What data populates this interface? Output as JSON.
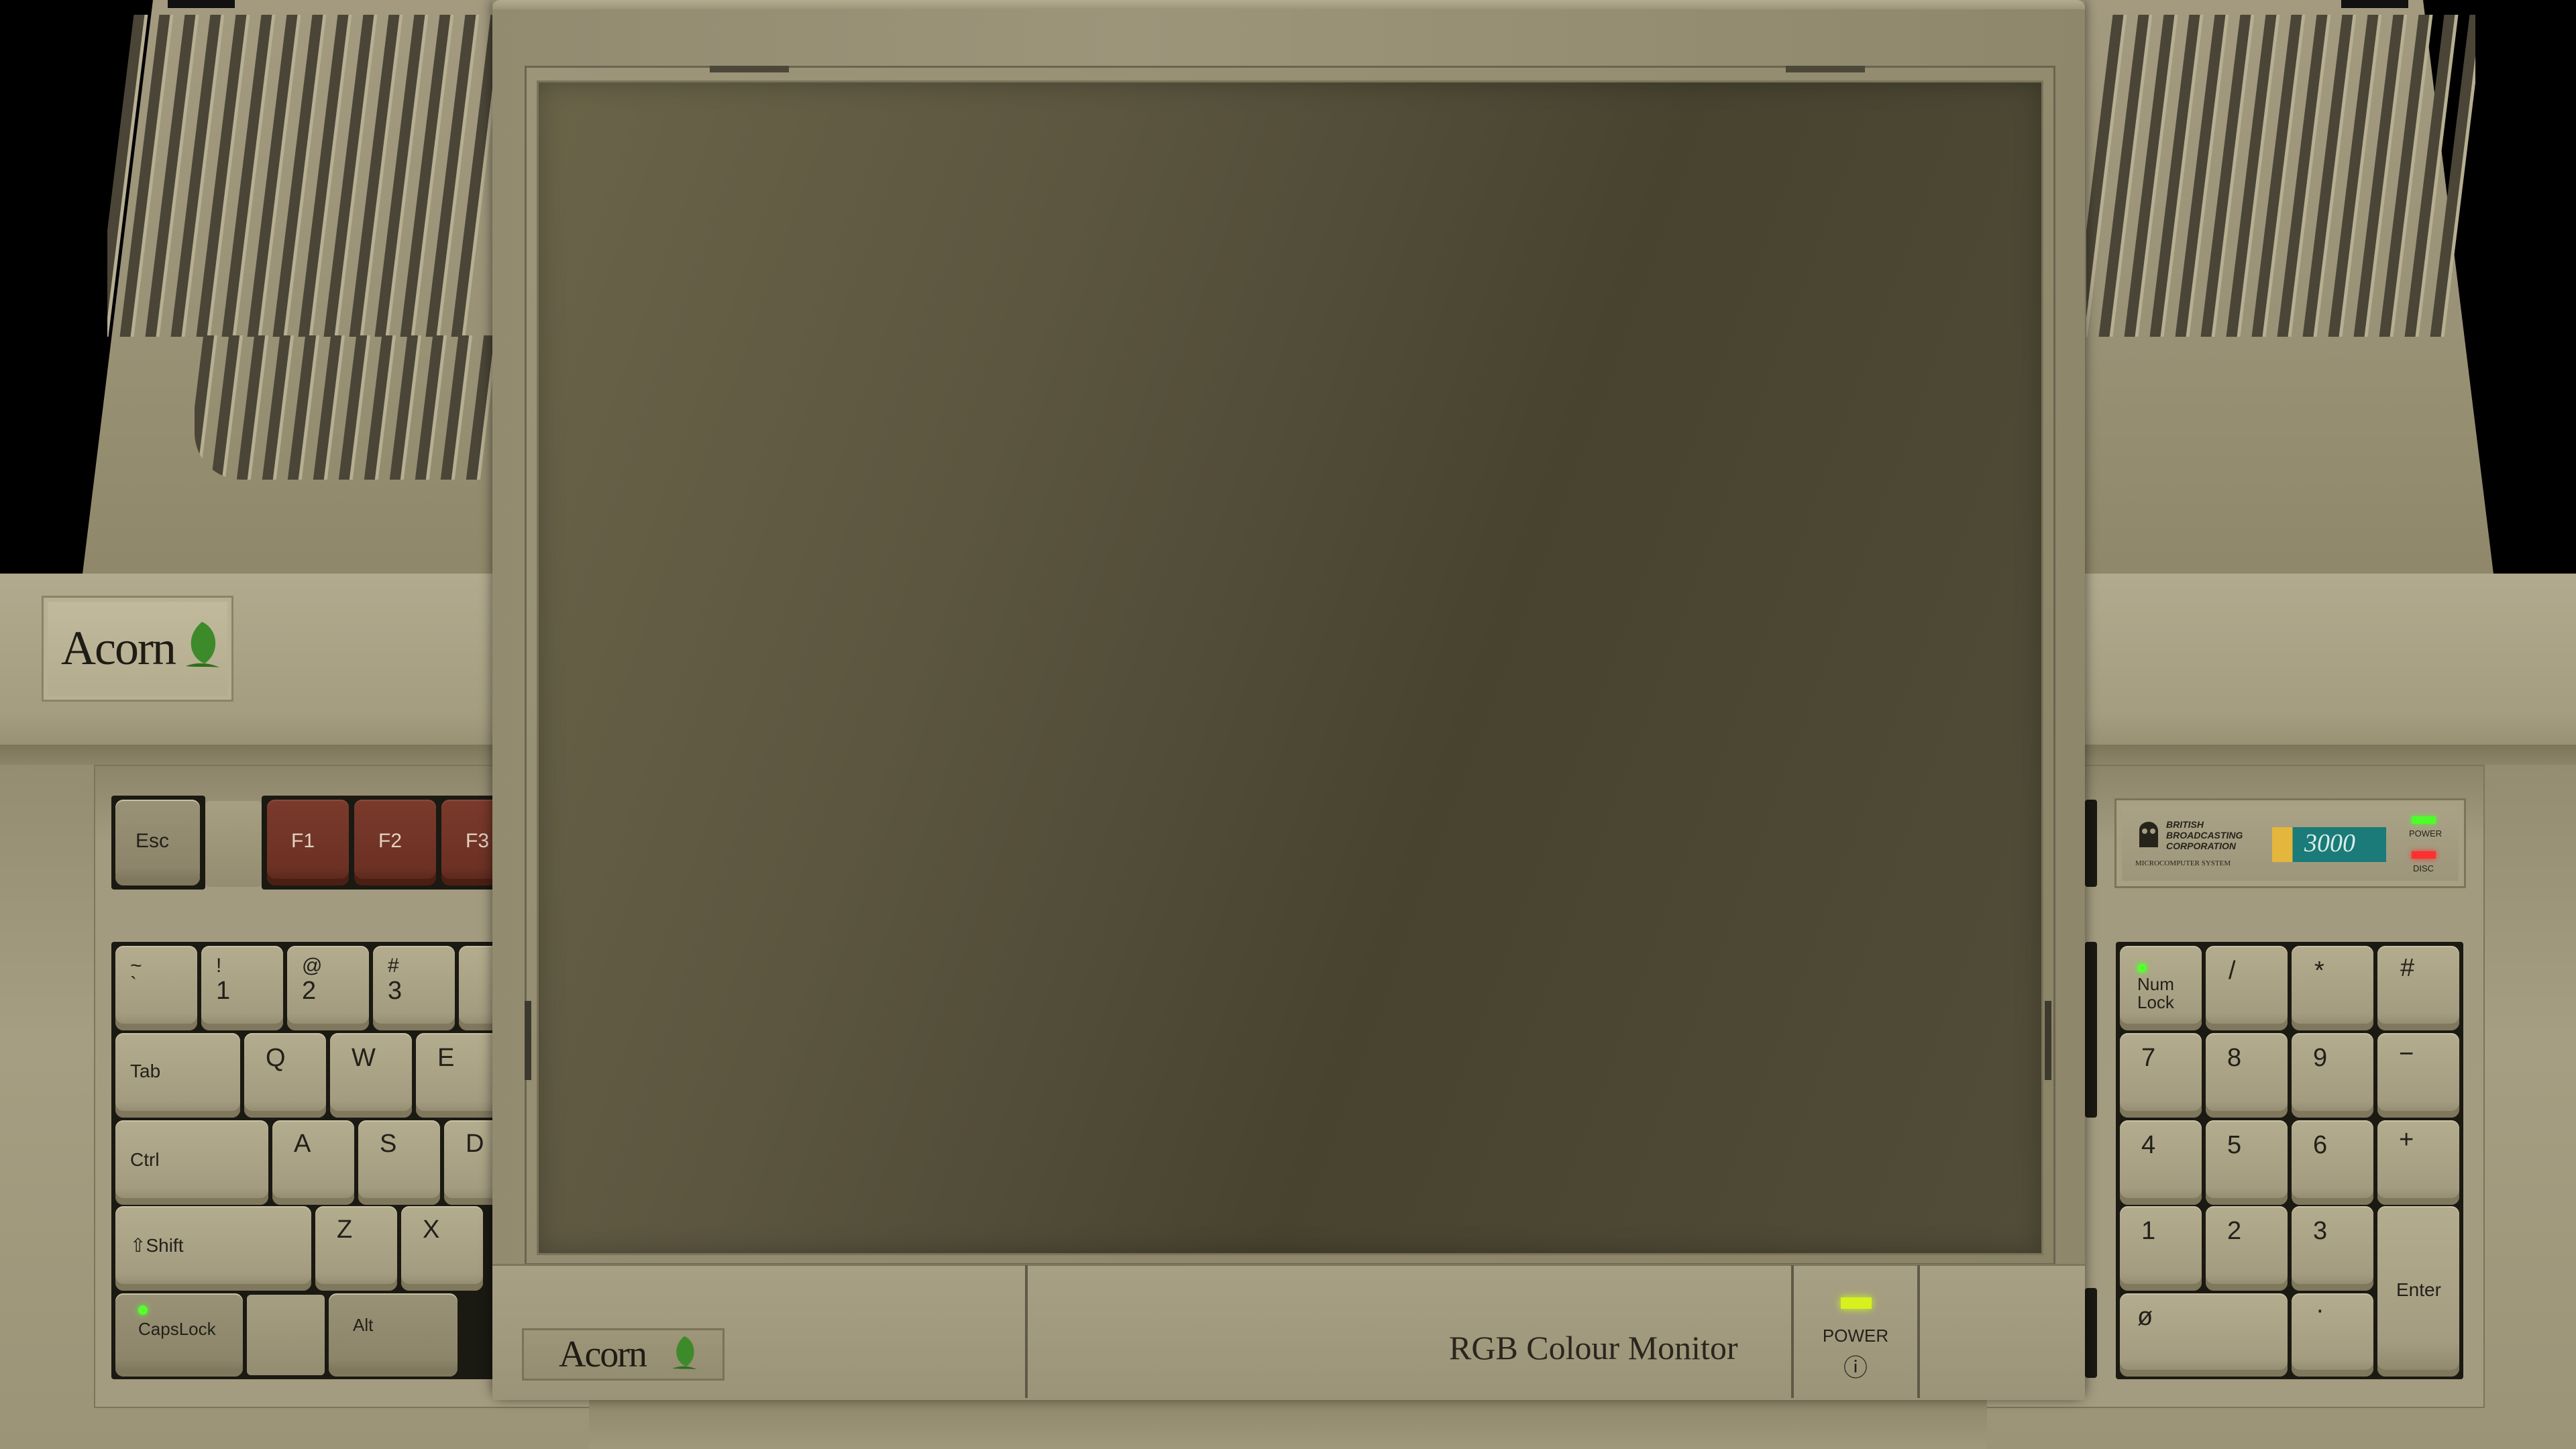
{
  "computer": {
    "brand": "Acorn",
    "panel": {
      "bbc_lines": [
        "BRITISH",
        "BROADCASTING",
        "CORPORATION"
      ],
      "bbc_sub": "MICROCOMPUTER SYSTEM",
      "model": "3000",
      "power_label": "POWER",
      "disc_label": "DISC"
    }
  },
  "keyboard": {
    "esc": "Esc",
    "function_keys": [
      "F1",
      "F2",
      "F3"
    ],
    "number_row": [
      {
        "top": "~",
        "bottom": "`"
      },
      {
        "top": "!",
        "bottom": "1"
      },
      {
        "top": "@",
        "bottom": "2"
      },
      {
        "top": "#",
        "bottom": "3"
      }
    ],
    "tab": "Tab",
    "q_row": [
      "Q",
      "W",
      "E"
    ],
    "ctrl": "Ctrl",
    "a_row": [
      "A",
      "S",
      "D"
    ],
    "shift": "⇧Shift",
    "z_row": [
      "Z",
      "X"
    ],
    "capslock": "CapsLock",
    "alt": "Alt"
  },
  "numpad": {
    "numlock": "Num\nLock",
    "row1": [
      "/",
      "*",
      "#"
    ],
    "row2": [
      "7",
      "8",
      "9",
      "−"
    ],
    "row3": [
      "4",
      "5",
      "6",
      "+"
    ],
    "row4": [
      "1",
      "2",
      "3"
    ],
    "zero": "ø",
    "dot": "·",
    "enter": "Enter"
  },
  "monitor": {
    "brand": "Acorn",
    "label": "RGB Colour Monitor",
    "power_label": "POWER",
    "power_symbol": "ⓘ"
  },
  "colors": {
    "led_green": "#56ff2e",
    "function_key_red": "#6c3124",
    "model_teal": "#1a7b78"
  }
}
